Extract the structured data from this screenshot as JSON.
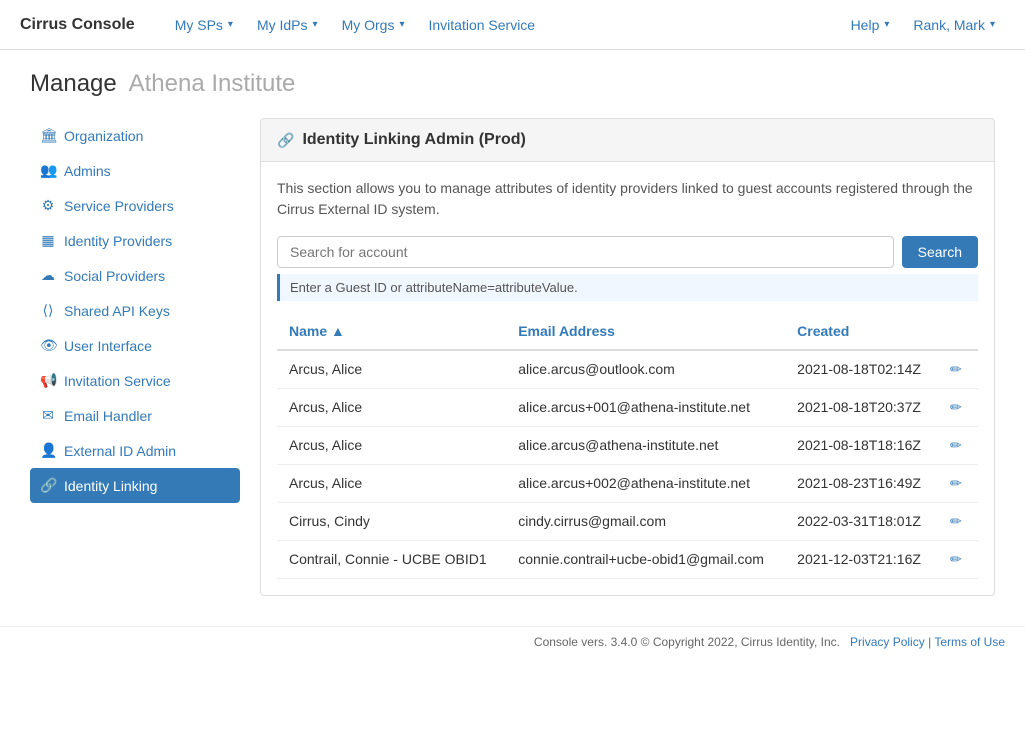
{
  "brand": "Cirrus Console",
  "nav": {
    "items": [
      {
        "label": "My SPs",
        "hasDropdown": true
      },
      {
        "label": "My IdPs",
        "hasDropdown": true
      },
      {
        "label": "My Orgs",
        "hasDropdown": true
      },
      {
        "label": "Invitation Service",
        "hasDropdown": false
      }
    ],
    "right": [
      {
        "label": "Help",
        "hasDropdown": true
      },
      {
        "label": "Rank, Mark",
        "hasDropdown": true
      }
    ]
  },
  "page": {
    "title": "Manage",
    "subtitle": "Athena Institute"
  },
  "sidebar": {
    "items": [
      {
        "id": "organization",
        "label": "Organization",
        "icon": "🏛"
      },
      {
        "id": "admins",
        "label": "Admins",
        "icon": "👥"
      },
      {
        "id": "service-providers",
        "label": "Service Providers",
        "icon": "⚙"
      },
      {
        "id": "identity-providers",
        "label": "Identity Providers",
        "icon": "▦"
      },
      {
        "id": "social-providers",
        "label": "Social Providers",
        "icon": "☁"
      },
      {
        "id": "shared-api-keys",
        "label": "Shared API Keys",
        "icon": "⟨⟩"
      },
      {
        "id": "user-interface",
        "label": "User Interface",
        "icon": "👁"
      },
      {
        "id": "invitation-service",
        "label": "Invitation Service",
        "icon": "📢"
      },
      {
        "id": "email-handler",
        "label": "Email Handler",
        "icon": "✉"
      },
      {
        "id": "external-id-admin",
        "label": "External ID Admin",
        "icon": "👤"
      },
      {
        "id": "identity-linking",
        "label": "Identity Linking",
        "icon": "🔗",
        "active": true
      }
    ]
  },
  "content": {
    "card_title": "Identity Linking Admin (Prod)",
    "card_icon": "🔗",
    "description": "This section allows you to manage attributes of identity providers linked to guest accounts registered through the Cirrus External ID system.",
    "search_placeholder": "Search for account",
    "search_button": "Search",
    "hint": "Enter a Guest ID or attributeName=attributeValue.",
    "table": {
      "columns": [
        {
          "label": "Name ▲",
          "key": "name"
        },
        {
          "label": "Email Address",
          "key": "email"
        },
        {
          "label": "Created",
          "key": "created"
        },
        {
          "label": "",
          "key": "action"
        }
      ],
      "rows": [
        {
          "name": "Arcus, Alice",
          "email": "alice.arcus@outlook.com",
          "created": "2021-08-18T02:14Z"
        },
        {
          "name": "Arcus, Alice",
          "email": "alice.arcus+001@athena-institute.net",
          "created": "2021-08-18T20:37Z"
        },
        {
          "name": "Arcus, Alice",
          "email": "alice.arcus@athena-institute.net",
          "created": "2021-08-18T18:16Z"
        },
        {
          "name": "Arcus, Alice",
          "email": "alice.arcus+002@athena-institute.net",
          "created": "2021-08-23T16:49Z"
        },
        {
          "name": "Cirrus, Cindy",
          "email": "cindy.cirrus@gmail.com",
          "created": "2022-03-31T18:01Z"
        },
        {
          "name": "Contrail, Connie - UCBE OBID1",
          "email": "connie.contrail+ucbe-obid1@gmail.com",
          "created": "2021-12-03T21:16Z"
        }
      ]
    }
  },
  "footer": {
    "text": "Console vers. 3.4.0 © Copyright 2022, Cirrus Identity, Inc.",
    "privacy_label": "Privacy Policy",
    "terms_label": "Terms of Use",
    "separator": "|"
  }
}
